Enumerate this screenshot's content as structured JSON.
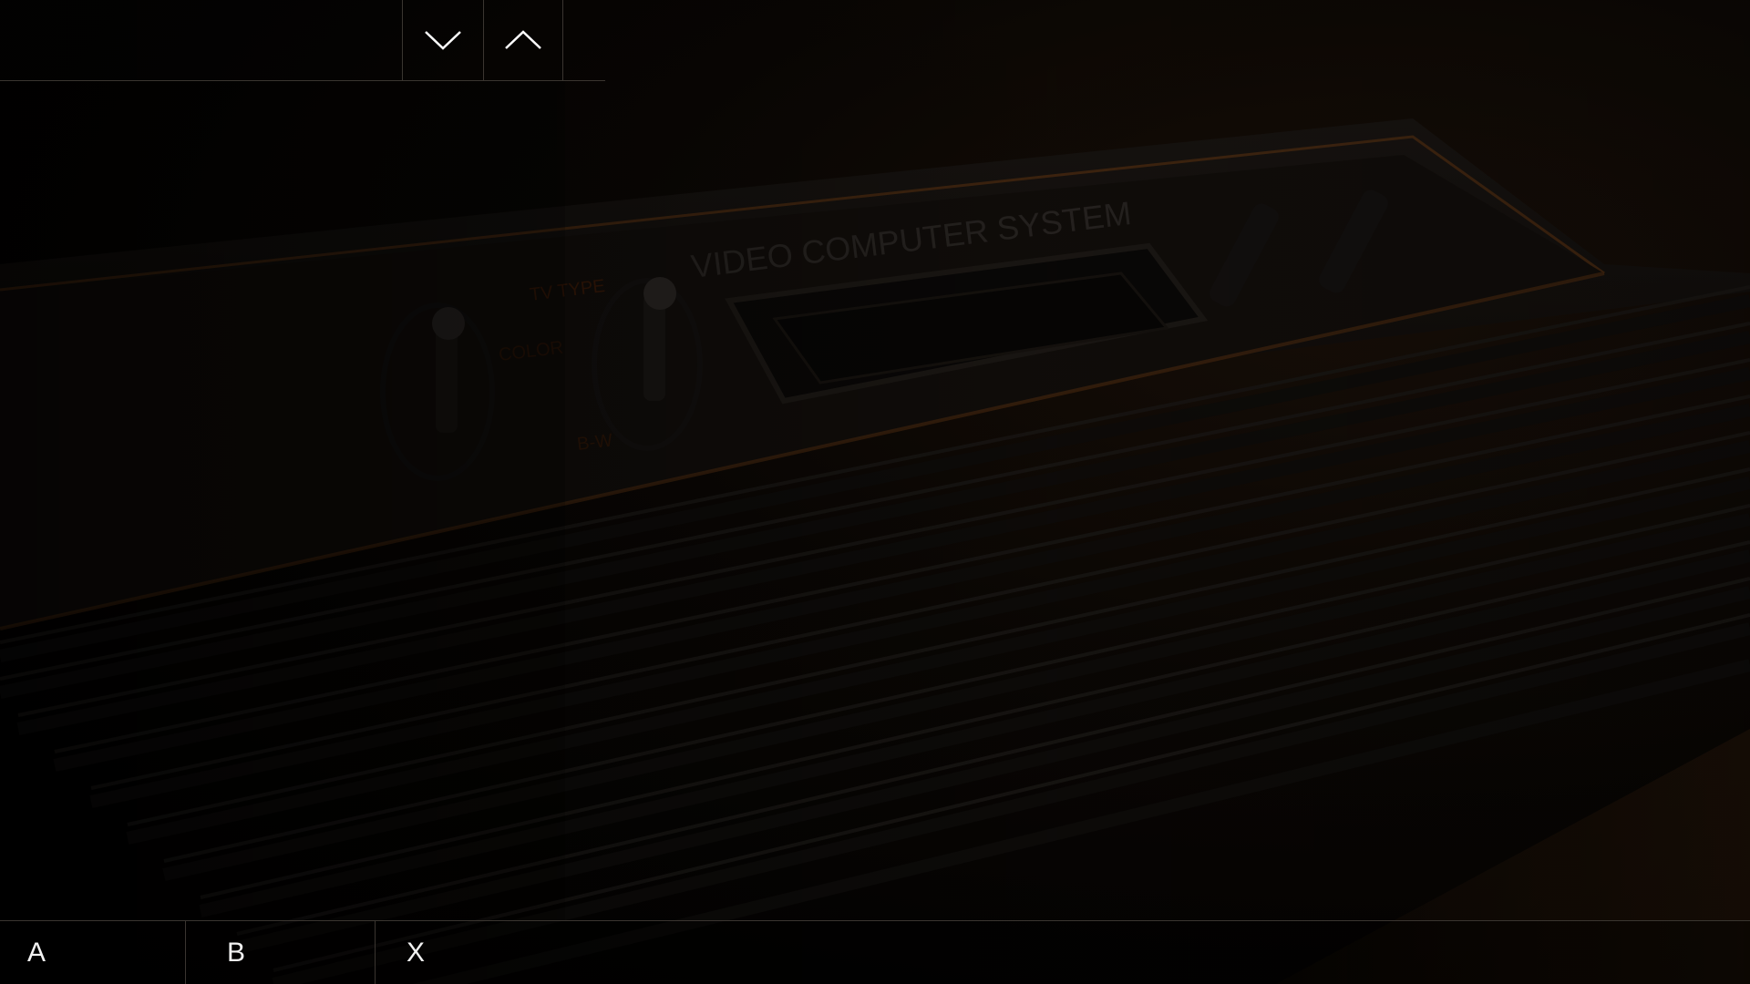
{
  "background": {
    "subject": "console",
    "console_label": "VIDEO COMPUTER SYSTEM",
    "switch_labels": [
      "TV TYPE",
      "COLOR",
      "B-W"
    ],
    "accent_color": "#6b3a12"
  },
  "top_nav": {
    "down_icon": "chevron-down-icon",
    "up_icon": "chevron-up-icon"
  },
  "bottom_bar": {
    "buttons": [
      {
        "label": "A"
      },
      {
        "label": "B"
      },
      {
        "label": "X"
      }
    ]
  }
}
